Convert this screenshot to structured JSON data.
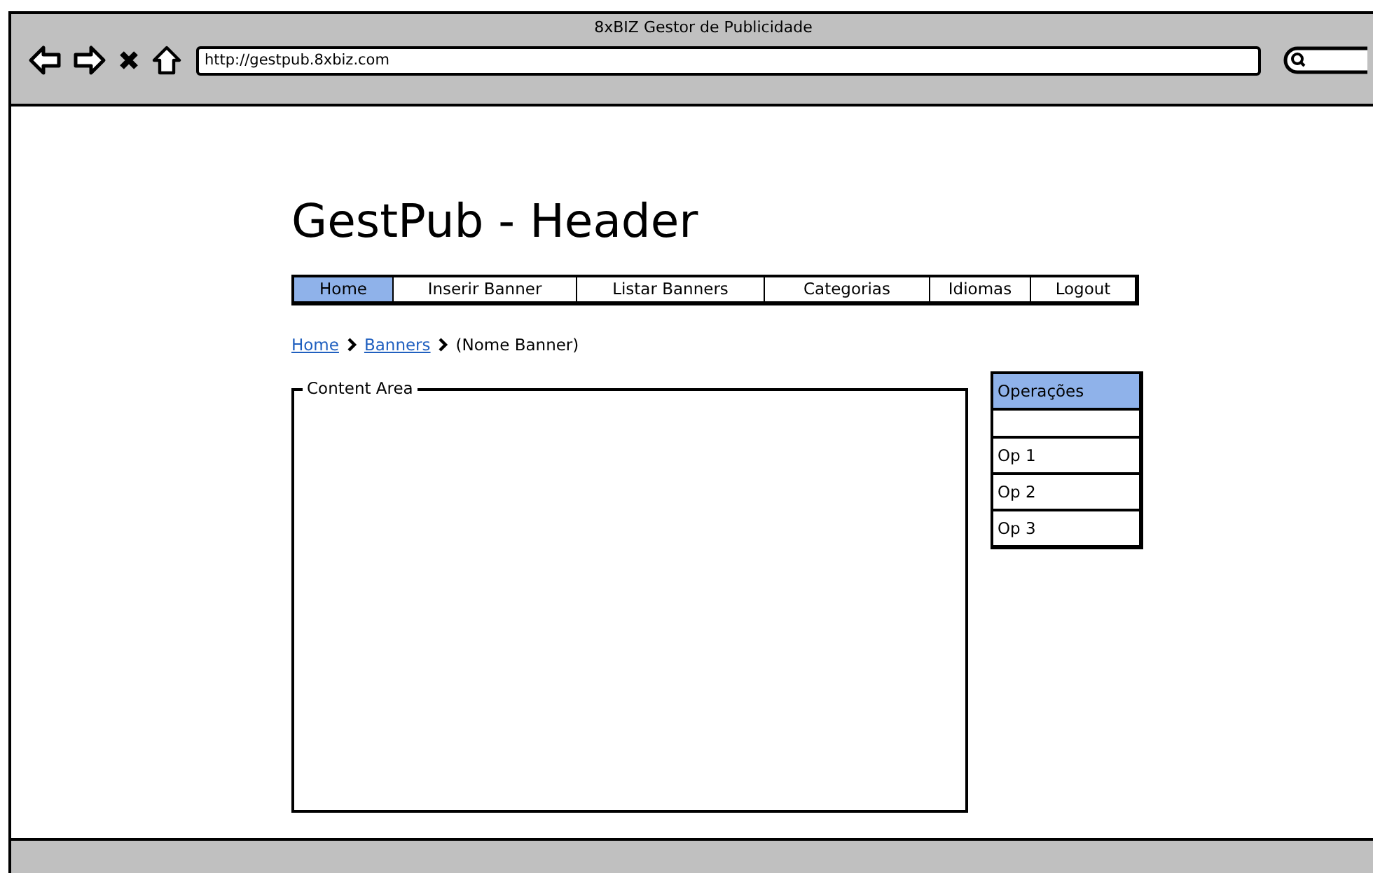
{
  "window": {
    "title": "8xBIZ Gestor de Publicidade",
    "address": "http://gestpub.8xbiz.com"
  },
  "page_title": "GestPub - Header",
  "nav": [
    {
      "label": "Home",
      "selected": true
    },
    {
      "label": "Inserir Banner",
      "selected": false
    },
    {
      "label": "Listar Banners",
      "selected": false
    },
    {
      "label": "Categorias",
      "selected": false
    },
    {
      "label": "Idiomas",
      "selected": false
    },
    {
      "label": "Logout",
      "selected": false
    }
  ],
  "breadcrumb": [
    {
      "label": "Home",
      "kind": "link"
    },
    {
      "label": "Banners",
      "kind": "link"
    },
    {
      "label": "(Nome Banner)",
      "kind": "current"
    }
  ],
  "content_area": {
    "legend": "Content Area"
  },
  "operations": {
    "header": "Operações",
    "items": [
      {
        "kind": "blank"
      },
      {
        "label": "Op 1"
      },
      {
        "label": "Op 2"
      },
      {
        "label": "Op 3"
      }
    ]
  }
}
